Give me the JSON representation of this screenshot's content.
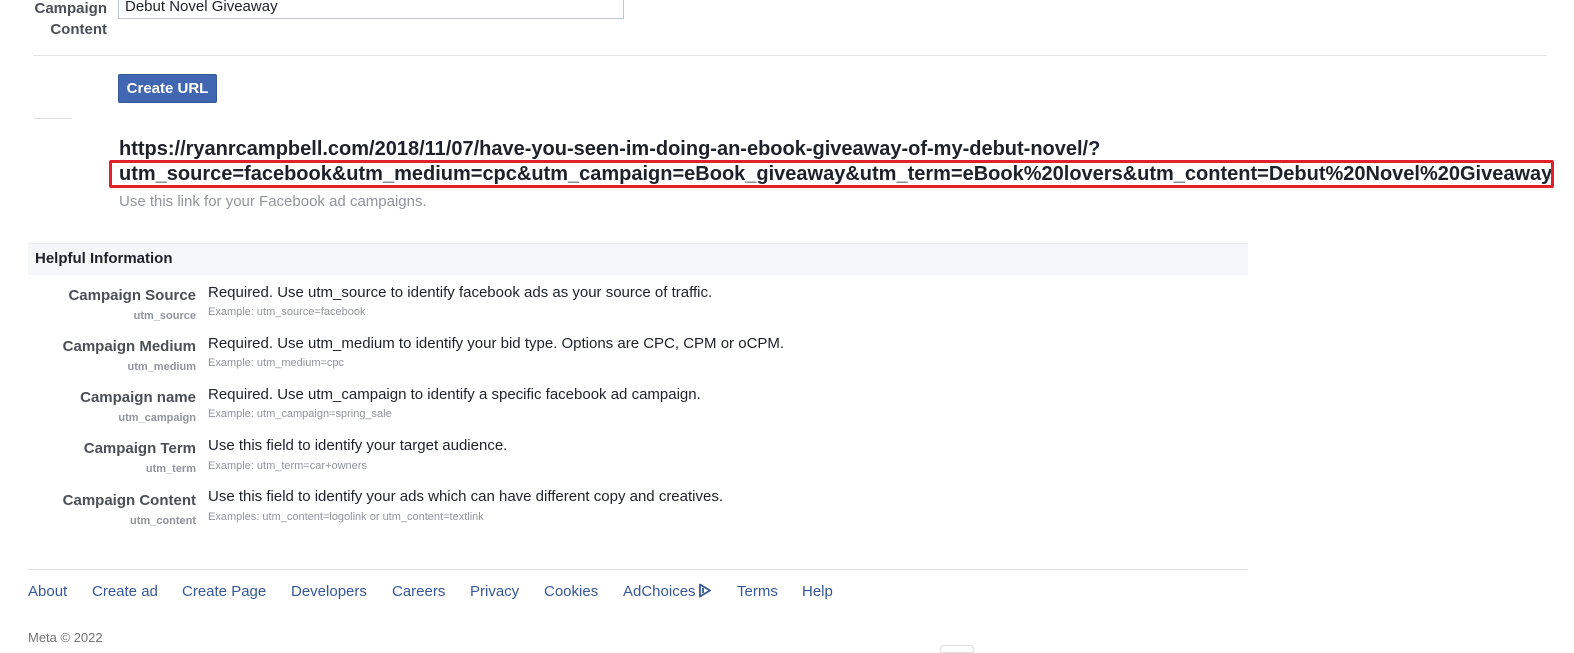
{
  "form": {
    "campaign_content_label_line1": "Campaign",
    "campaign_content_label_line2": "Content",
    "campaign_content_value": "Debut Novel Giveaway",
    "create_url_button": "Create URL",
    "generated_url_line1": "https://ryanrcampbell.com/2018/11/07/have-you-seen-im-doing-an-ebook-giveaway-of-my-debut-novel/?",
    "generated_url_line2": "utm_source=facebook&utm_medium=cpc&utm_campaign=eBook_giveaway&utm_term=eBook%20lovers&utm_content=Debut%20Novel%20Giveaway",
    "hint": "Use this link for your Facebook ad campaigns.",
    "highlight_color": "#e0202a"
  },
  "info": {
    "title": "Helpful Information",
    "rows": [
      {
        "name": "Campaign Source",
        "param": "utm_source",
        "desc": "Required. Use utm_source to identify facebook ads as your source of traffic.",
        "example": "Example: utm_source=facebook"
      },
      {
        "name": "Campaign Medium",
        "param": "utm_medium",
        "desc": "Required. Use utm_medium to identify your bid type. Options are CPC, CPM or oCPM.",
        "example": "Example: utm_medium=cpc"
      },
      {
        "name": "Campaign name",
        "param": "utm_campaign",
        "desc": "Required. Use utm_campaign to identify a specific facebook ad campaign.",
        "example": "Example: utm_campaign=spring_sale"
      },
      {
        "name": "Campaign Term",
        "param": "utm_term",
        "desc": "Use this field to identify your target audience.",
        "example": "Example: utm_term=car+owners"
      },
      {
        "name": "Campaign Content",
        "param": "utm_content",
        "desc": "Use this field to identify your ads which can have different copy and creatives.",
        "example": "Examples: utm_content=logolink or utm_content=textlink"
      }
    ]
  },
  "footer": {
    "links": {
      "about": "About",
      "create_ad": "Create ad",
      "create_page": "Create Page",
      "developers": "Developers",
      "careers": "Careers",
      "privacy": "Privacy",
      "cookies": "Cookies",
      "adchoices": "AdChoices",
      "terms": "Terms",
      "help": "Help"
    },
    "adchoices_icon": "adchoices-icon",
    "copyright": "Meta © 2022",
    "link_color": "#365899"
  }
}
